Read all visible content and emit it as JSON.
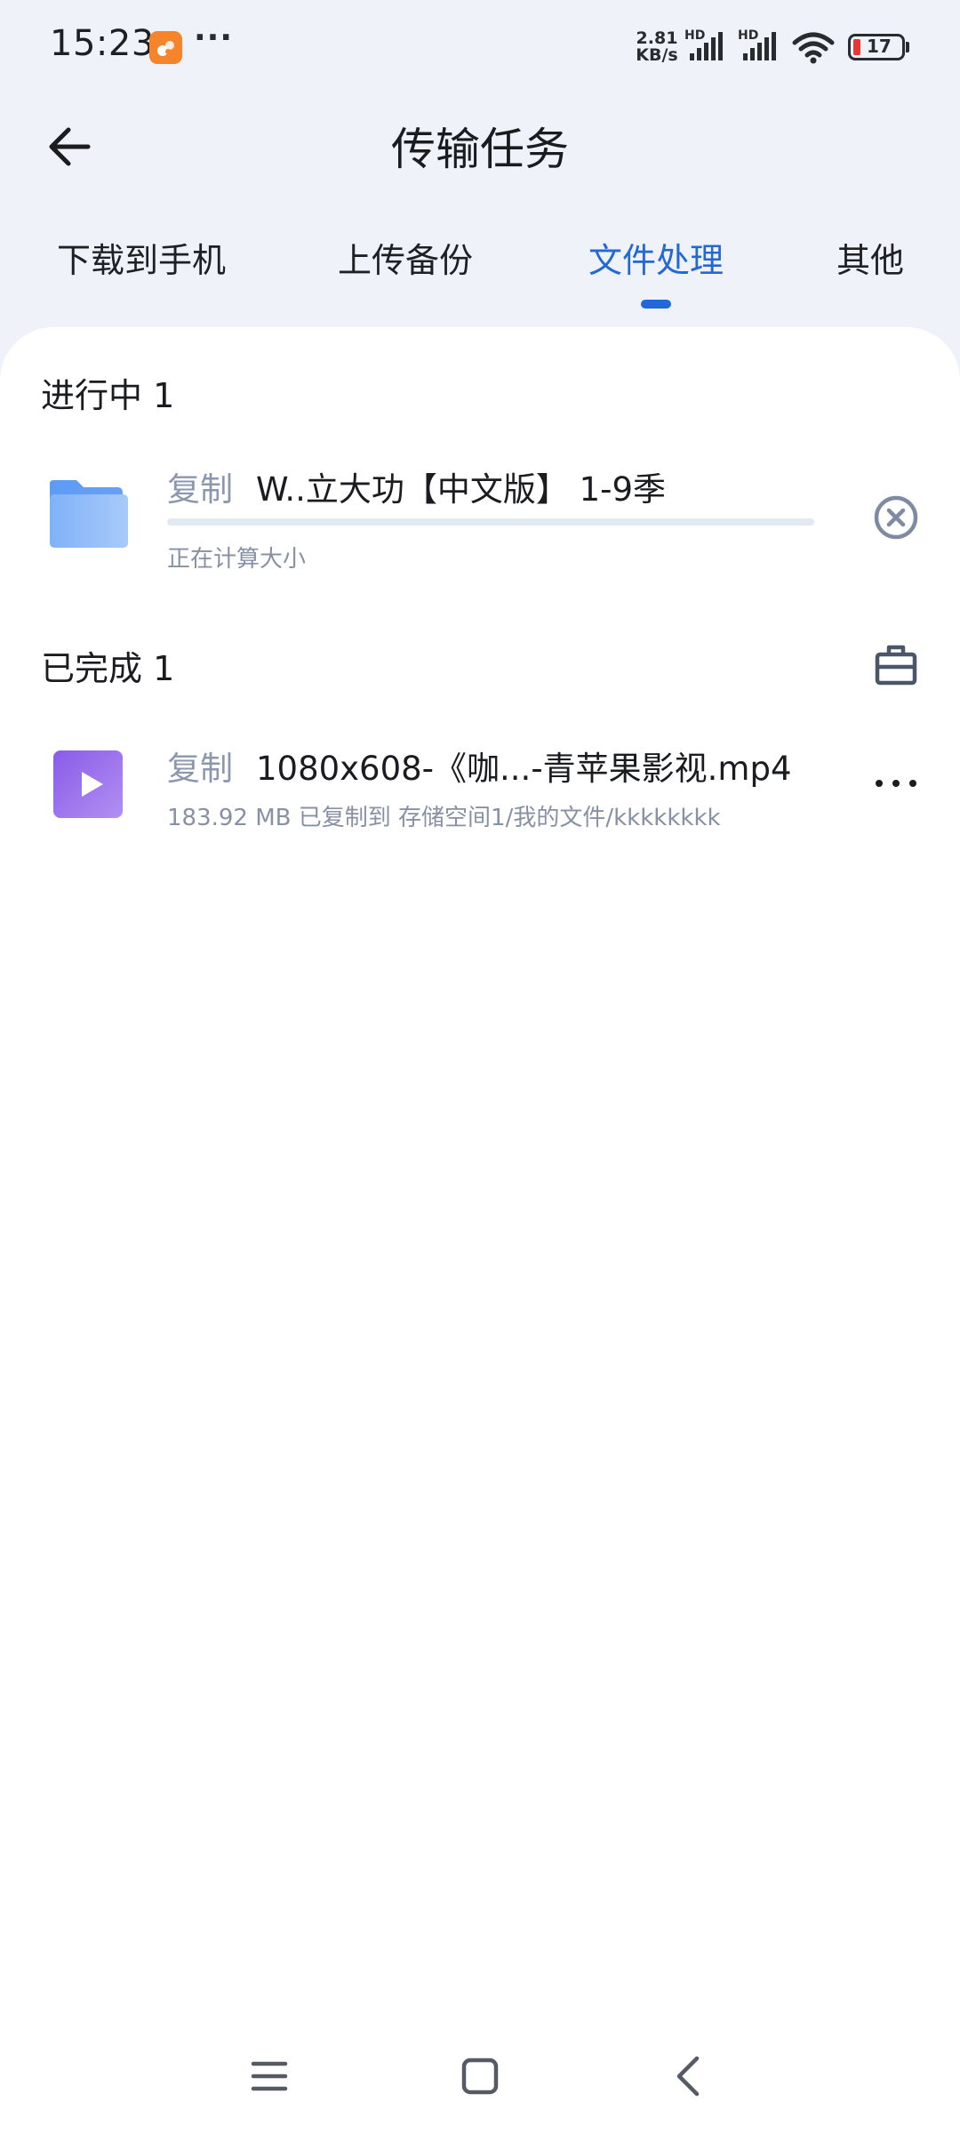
{
  "status_bar": {
    "time": "15:23",
    "app_icon": "app-notification-icon",
    "more_dots": "···",
    "net_speed_value": "2.81",
    "net_speed_unit": "KB/s",
    "signal_1_label": "HD",
    "signal_2_label": "HD",
    "battery_level": "17",
    "battery_color": "#e53935"
  },
  "header": {
    "title": "传输任务",
    "back_icon": "arrow-left-icon"
  },
  "tabs": [
    {
      "label": "下载到手机",
      "active": false
    },
    {
      "label": "上传备份",
      "active": false
    },
    {
      "label": "文件处理",
      "active": true
    },
    {
      "label": "其他",
      "active": false
    }
  ],
  "accent_color": "#2268d6",
  "in_progress": {
    "header": "进行中 1",
    "items": [
      {
        "icon": "folder-icon",
        "action": "复制",
        "name": "W..立大功【中文版】 1-9季",
        "progress": 0,
        "status": "正在计算大小",
        "control_icon": "cancel-circle-icon"
      }
    ]
  },
  "completed": {
    "header": "已完成 1",
    "header_icon": "toolbox-icon",
    "items": [
      {
        "icon": "video-file-icon",
        "action": "复制",
        "name": "1080x608-《咖...-青苹果影视.mp4",
        "detail": "183.92 MB 已复制到 存储空间1/我的文件/kkkkkkkk",
        "control_icon": "more-horizontal-icon"
      }
    ]
  },
  "nav_bar": {
    "menu_icon": "menu-icon",
    "home_icon": "home-square-icon",
    "back_icon": "back-chevron-icon"
  }
}
